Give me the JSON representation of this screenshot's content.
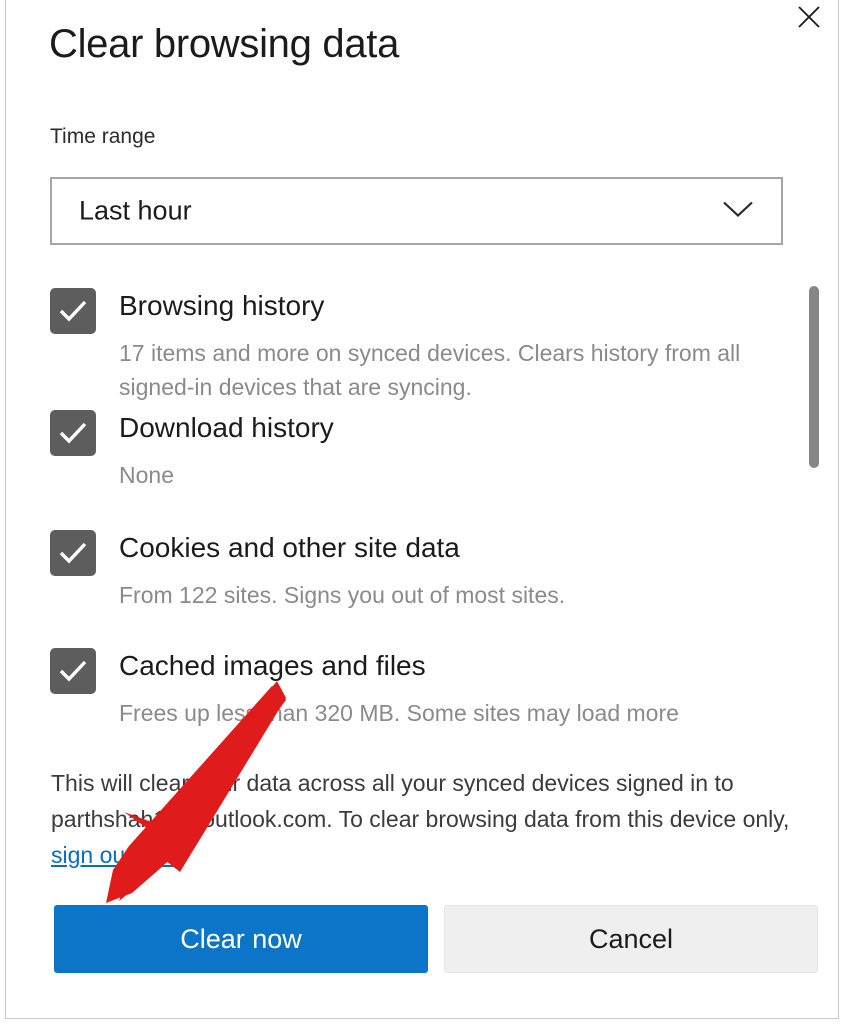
{
  "dialog": {
    "title": "Clear browsing data",
    "close_icon": "close-icon"
  },
  "time_range": {
    "label": "Time range",
    "selected": "Last hour",
    "chevron_icon": "chevron-down-icon"
  },
  "options": [
    {
      "id": "browsing-history",
      "label": "Browsing history",
      "description": "17 items and more on synced devices. Clears history from all signed-in devices that are syncing.",
      "checked": true,
      "check_icon": "check-icon"
    },
    {
      "id": "download-history",
      "label": "Download history",
      "description": "None",
      "checked": true,
      "check_icon": "check-icon"
    },
    {
      "id": "cookies-and-site-data",
      "label": "Cookies and other site data",
      "description": "From 122 sites. Signs you out of most sites.",
      "checked": true,
      "check_icon": "check-icon"
    },
    {
      "id": "cached-images-and-files",
      "label": "Cached images and files",
      "description": "Frees up less than 320 MB. Some sites may load more",
      "checked": true,
      "check_icon": "check-icon"
    }
  ],
  "footer": {
    "note_part1": "This will clear your data across all your synced devices signed in to parthshah1",
    "note_part2": "7@outlook.com. To clear browsing data from this device only, ",
    "signout_link": "sign out first",
    "note_end": "."
  },
  "buttons": {
    "primary": "Clear now",
    "secondary": "Cancel"
  },
  "colors": {
    "accent": "#0d75c8",
    "checkbox": "#5d5d5d",
    "link": "#0b6bbd",
    "annotation_arrow": "#e01b1b",
    "muted_text": "#8a8a8a"
  },
  "scrollbar": {
    "name": "vertical-scrollbar"
  },
  "annotation": {
    "type": "arrow",
    "color": "#e01b1b",
    "points_to": "Clear now"
  }
}
